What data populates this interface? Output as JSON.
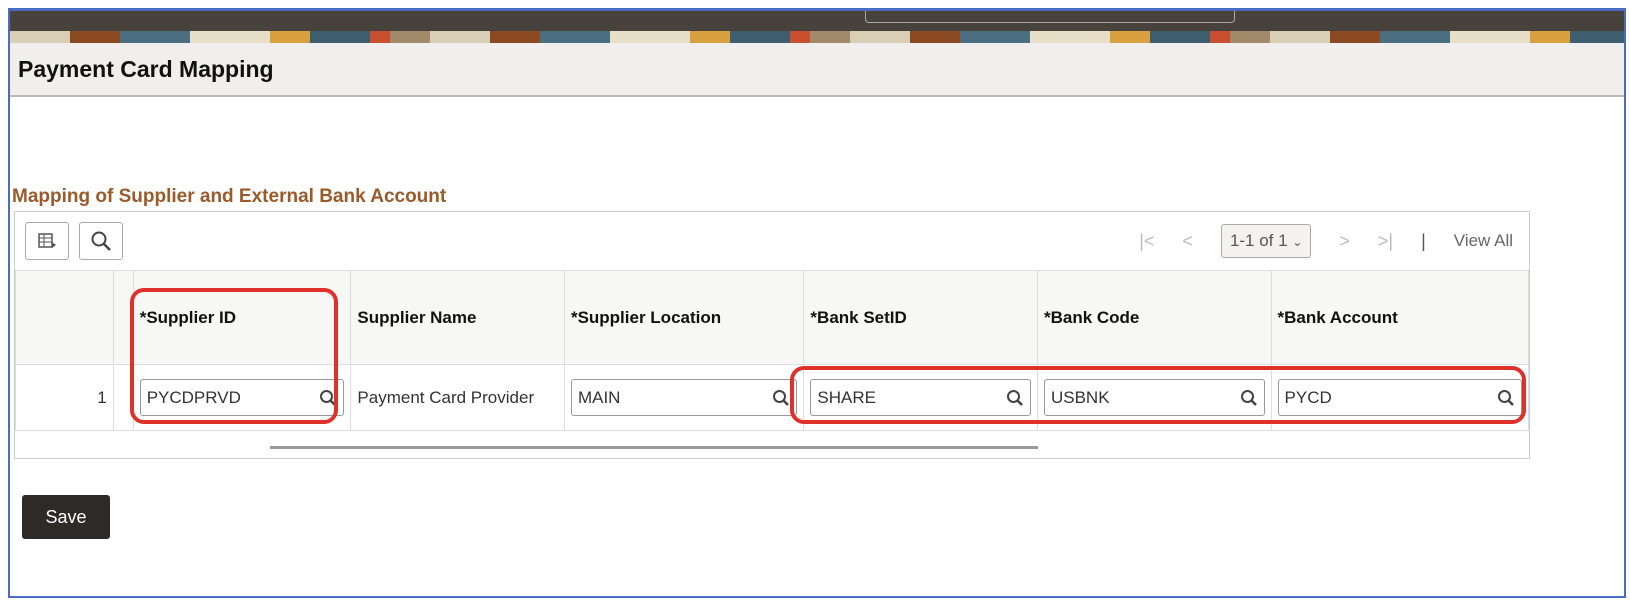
{
  "page_title": "Payment Card Mapping",
  "section_title": "Mapping of Supplier and External Bank Account",
  "pager": {
    "range": "1-1 of 1",
    "view_all": "View All"
  },
  "columns": [
    "*Supplier ID",
    "Supplier Name",
    "*Supplier Location",
    "*Bank SetID",
    "*Bank Code",
    "*Bank Account"
  ],
  "rows": [
    {
      "num": "1",
      "supplier_id": "PYCDPRVD",
      "supplier_name": "Payment Card Provider",
      "supplier_location": "MAIN",
      "bank_setid": "SHARE",
      "bank_code": "USBNK",
      "bank_account": "PYCD"
    }
  ],
  "save_label": "Save",
  "colors": {
    "accent": "#9b5a2a",
    "highlight": "#e0302a"
  }
}
